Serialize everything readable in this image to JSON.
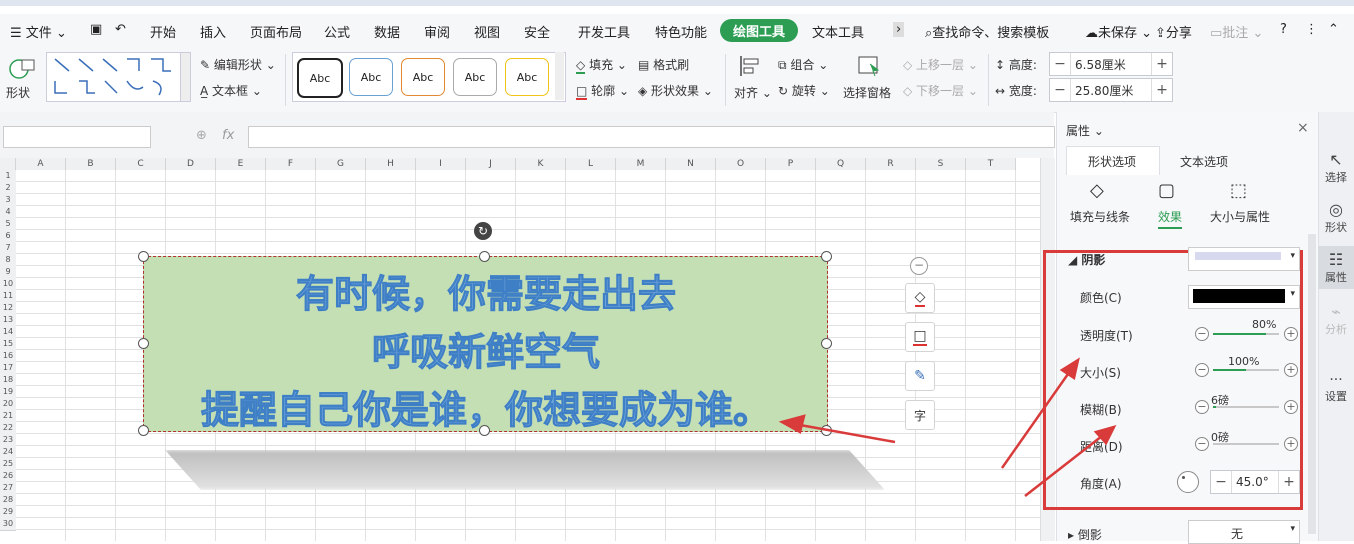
{
  "menu": {
    "file": "文件",
    "items": [
      "开始",
      "插入",
      "页面布局",
      "公式",
      "数据",
      "审阅",
      "视图",
      "安全",
      "开发工具",
      "特色功能"
    ],
    "active": "绘图工具",
    "text_tools": "文本工具",
    "search": "查找命令、搜索模板",
    "unsaved": "未保存",
    "share": "分享",
    "comment": "批注",
    "help": "?"
  },
  "ribbon": {
    "shape": "形状",
    "edit_shape": "编辑形状",
    "textbox": "文本框",
    "style_sample": "Abc",
    "fill": "填充",
    "format_brush": "格式刷",
    "outline": "轮廓",
    "shape_effect": "形状效果",
    "align": "对齐",
    "group": "组合",
    "rotate": "旋转",
    "select_pane": "选择窗格",
    "bring_forward": "上移一层",
    "send_backward": "下移一层",
    "height_label": "高度:",
    "height_value": "6.58厘米",
    "width_label": "宽度:",
    "width_value": "25.80厘米"
  },
  "formula": {
    "fx": "fx"
  },
  "columns": [
    "A",
    "B",
    "C",
    "D",
    "E",
    "F",
    "G",
    "H",
    "I",
    "J",
    "K",
    "L",
    "M",
    "N",
    "O",
    "P",
    "Q",
    "R",
    "S",
    "T"
  ],
  "rows": [
    "1",
    "2",
    "3",
    "4",
    "5",
    "6",
    "7",
    "8",
    "9",
    "10",
    "11",
    "12",
    "13",
    "14",
    "15",
    "16",
    "17",
    "18",
    "19",
    "20",
    "21",
    "22",
    "23",
    "24",
    "25",
    "26",
    "27",
    "28",
    "29",
    "30"
  ],
  "shape": {
    "line1": "有时候，你需要走出去",
    "line2": "呼吸新鲜空气",
    "line3": "提醒自己你是谁，你想要成为谁。"
  },
  "panel": {
    "title": "属性",
    "tab_shape": "形状选项",
    "tab_text": "文本选项",
    "sub_fill": "填充与线条",
    "sub_effect": "效果",
    "sub_size": "大小与属性",
    "shadow": "阴影",
    "color_label": "颜色(C)",
    "transparency_label": "透明度(T)",
    "transparency_value": "80%",
    "transparency_level": 0.8,
    "size_label": "大小(S)",
    "size_value": "100%",
    "size_level": 0.5,
    "blur_label": "模糊(B)",
    "blur_value": "6磅",
    "blur_level": 0.05,
    "distance_label": "距离(D)",
    "distance_value": "0磅",
    "angle_label": "角度(A)",
    "angle_value": "45.0°",
    "reflection_label": "倒影",
    "reflection_value": "无",
    "shadow_color": "#000000"
  },
  "rightbar": {
    "select": "选择",
    "shape": "形状",
    "props": "属性",
    "analyze": "分析",
    "settings": "设置"
  },
  "colors": {
    "accent_green": "#2c9d53",
    "shape_fill": "#c5dfb5",
    "highlight_red": "#d93a3a"
  }
}
